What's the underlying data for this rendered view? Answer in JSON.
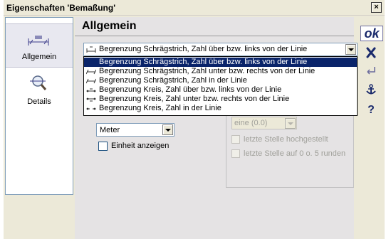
{
  "window": {
    "title": "Eigenschaften 'Bemaßung'",
    "close_label": "×"
  },
  "sidebar": {
    "items": [
      {
        "label": "Allgemein",
        "icon": "dimension-line-icon",
        "active": true
      },
      {
        "label": "Details",
        "icon": "magnifier-icon",
        "active": false
      }
    ]
  },
  "main": {
    "heading": "Allgemein",
    "style_select": {
      "value": "Begrenzung Schrägstrich, Zahl über bzw. links von der Linie",
      "options": [
        "Begrenzung Schrägstrich, Zahl über bzw. links von der Linie",
        "Begrenzung Schrägstrich,  Zahl unter bzw. rechts von der Linie",
        "Begrenzung Schrägstrich, Zahl in der Linie",
        "Begrenzung Kreis, Zahl über bzw. links von der Linie",
        "Begrenzung Kreis, Zahl unter bzw. rechts von der Linie",
        "Begrenzung Kreis, Zahl in der Linie"
      ],
      "selected_index": 0
    },
    "unit_select": {
      "value": "Meter"
    },
    "show_unit_checkbox": {
      "label": "Einheit anzeigen",
      "checked": false
    },
    "precision_select": {
      "value": "eine (0.0)",
      "disabled": true
    },
    "superscript_checkbox": {
      "label": "letzte Stelle hochgestellt",
      "checked": false,
      "disabled": true
    },
    "round_checkbox": {
      "label": "letzte Stelle auf 0 o. 5 runden",
      "checked": false,
      "disabled": true
    }
  },
  "toolbar": {
    "ok_label": "ok",
    "buttons": [
      "cancel-icon",
      "enter-icon",
      "anchor-icon",
      "help-icon"
    ],
    "help_label": "?"
  },
  "colors": {
    "selection": "#0a246a",
    "dialog_bg": "#ece9d8",
    "content_bg": "#e5e3e4",
    "toolbar_icon": "#1a2a6c"
  }
}
